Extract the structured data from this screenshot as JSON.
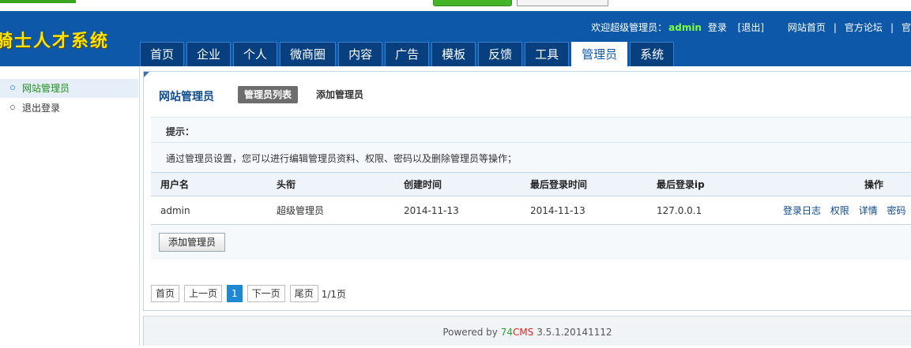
{
  "header": {
    "logo": "骑士人才系统",
    "welcome_prefix": "欢迎超级管理员：",
    "username": "admin",
    "login_link": "登录",
    "logout_link": "[退出]",
    "links": [
      "网站首页",
      "官方论坛",
      "官"
    ],
    "separator": "|"
  },
  "tabs": [
    {
      "label": "首页",
      "active": false
    },
    {
      "label": "企业",
      "active": false
    },
    {
      "label": "个人",
      "active": false
    },
    {
      "label": "微商圈",
      "active": false
    },
    {
      "label": "内容",
      "active": false
    },
    {
      "label": "广告",
      "active": false
    },
    {
      "label": "模板",
      "active": false
    },
    {
      "label": "反馈",
      "active": false
    },
    {
      "label": "工具",
      "active": false
    },
    {
      "label": "管理员",
      "active": true
    },
    {
      "label": "系统",
      "active": false
    }
  ],
  "sidebar": {
    "items": [
      {
        "label": "网站管理员",
        "active": true
      },
      {
        "label": "退出登录",
        "active": false
      }
    ]
  },
  "main": {
    "title": "网站管理员",
    "subtabs": [
      {
        "label": "管理员列表",
        "active": true
      },
      {
        "label": "添加管理员",
        "active": false
      }
    ],
    "tip_title": "提示：",
    "tip_text": "通过管理员设置，您可以进行编辑管理员资料、权限、密码以及删除管理员等操作；",
    "table": {
      "headers": [
        "用户名",
        "头衔",
        "创建时间",
        "最后登录时间",
        "最后登录ip",
        "操作"
      ],
      "rows": [
        {
          "username": "admin",
          "title": "超级管理员",
          "created": "2014-11-13",
          "last_login": "2014-11-13",
          "last_ip": "127.0.0.1",
          "actions": [
            "登录日志",
            "权限",
            "详情",
            "密码"
          ]
        }
      ]
    },
    "add_button": "添加管理员",
    "pagination": {
      "first": "首页",
      "prev": "上一页",
      "current": "1",
      "next": "下一页",
      "last": "尾页",
      "info": "1/1页"
    }
  },
  "footer": {
    "powered_by": "Powered by",
    "brand_74": "74",
    "brand_cms": "CMS",
    "version": "3.5.1.20141112"
  }
}
